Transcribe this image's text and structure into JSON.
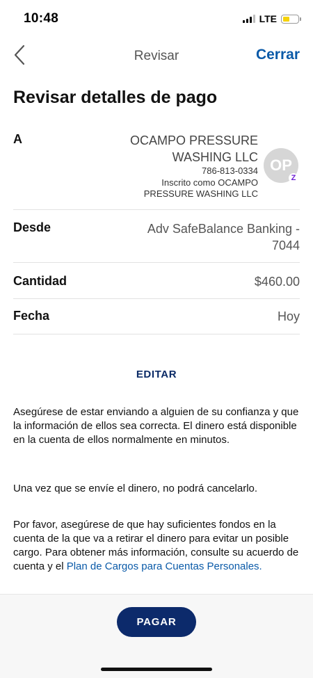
{
  "status_bar": {
    "time": "10:48",
    "network": "LTE",
    "battery_color": "#f5d20a"
  },
  "nav": {
    "back_icon": "chevron-left-icon",
    "title": "Revisar",
    "close_label": "Cerrar",
    "accent_color": "#0a5aa8"
  },
  "page_title": "Revisar detalles de pago",
  "payee": {
    "label": "A",
    "name": "OCAMPO PRESSURE WASHING LLC",
    "phone": "786-813-0334",
    "enrolled_as": "Inscrito como OCAMPO PRESSURE WASHING LLC",
    "avatar_initials": "OP",
    "badge": "Z"
  },
  "from": {
    "label": "Desde",
    "account": "Adv SafeBalance Banking - 7044"
  },
  "amount": {
    "label": "Cantidad",
    "value": "$460.00"
  },
  "date": {
    "label": "Fecha",
    "value": "Hoy"
  },
  "edit_label": "EDITAR",
  "disclaimers": {
    "trust": "Asegúrese de estar enviando a alguien de su confianza y que la información de ellos sea correcta. El dinero está disponible en la cuenta de ellos normalmente en minutos.",
    "cancel": "Una vez que se envíe el dinero, no podrá cancelarlo.",
    "funds": "Por favor, asegúrese de que hay suficientes fondos en la cuenta de la que va a retirar el dinero para evitar un posible cargo. Para obtener más información, consulte su acuerdo de cuenta y el",
    "fee_link": "Plan de Cargos para Cuentas Personales."
  },
  "pay_label": "PAGAR",
  "pay_color": "#0c2a6b"
}
